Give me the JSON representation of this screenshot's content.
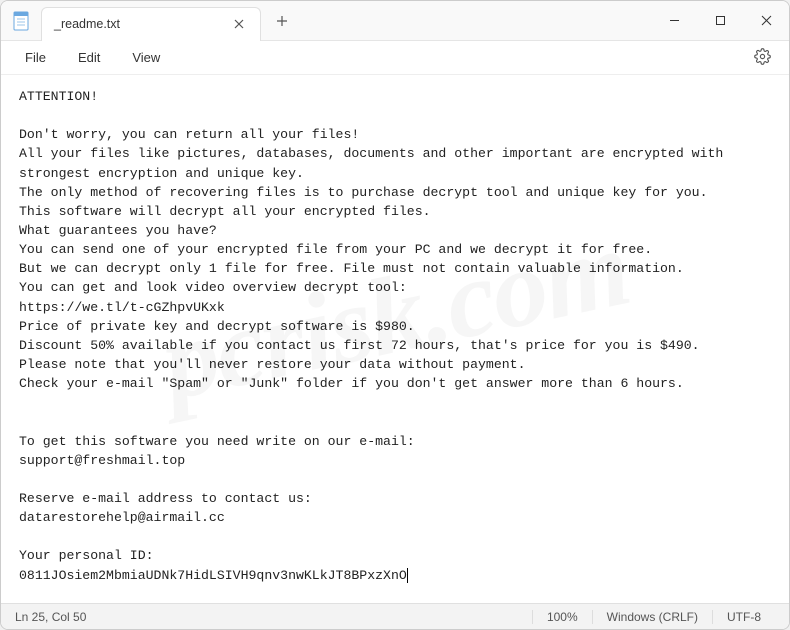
{
  "titlebar": {
    "tab_title": "_readme.txt"
  },
  "menubar": {
    "file": "File",
    "edit": "Edit",
    "view": "View"
  },
  "document": {
    "lines": [
      "ATTENTION!",
      "",
      "Don't worry, you can return all your files!",
      "All your files like pictures, databases, documents and other important are encrypted with strongest encryption and unique key.",
      "The only method of recovering files is to purchase decrypt tool and unique key for you.",
      "This software will decrypt all your encrypted files.",
      "What guarantees you have?",
      "You can send one of your encrypted file from your PC and we decrypt it for free.",
      "But we can decrypt only 1 file for free. File must not contain valuable information.",
      "You can get and look video overview decrypt tool:",
      "https://we.tl/t-cGZhpvUKxk",
      "Price of private key and decrypt software is $980.",
      "Discount 50% available if you contact us first 72 hours, that's price for you is $490.",
      "Please note that you'll never restore your data without payment.",
      "Check your e-mail \"Spam\" or \"Junk\" folder if you don't get answer more than 6 hours.",
      "",
      "",
      "To get this software you need write on our e-mail:",
      "support@freshmail.top",
      "",
      "Reserve e-mail address to contact us:",
      "datarestorehelp@airmail.cc",
      "",
      "Your personal ID:",
      "0811JOsiem2MbmiaUDNk7HidLSIVH9qnv3nwKLkJT8BPxzXnO"
    ]
  },
  "statusbar": {
    "position": "Ln 25, Col 50",
    "zoom": "100%",
    "line_ending": "Windows (CRLF)",
    "encoding": "UTF-8"
  },
  "watermark": "pcrisk.com"
}
